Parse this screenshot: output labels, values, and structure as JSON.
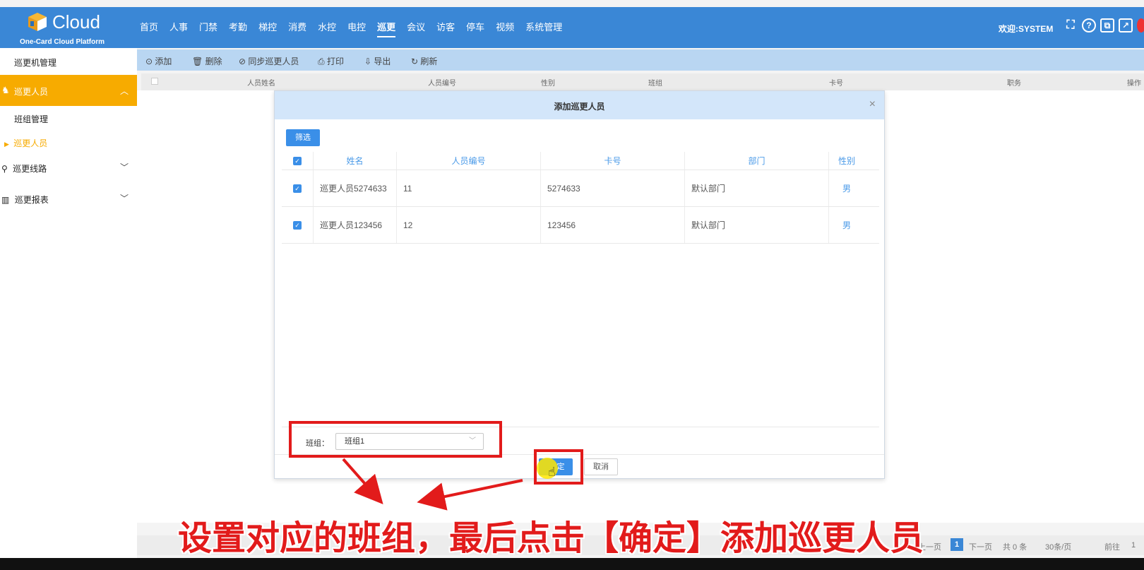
{
  "header": {
    "logo_text": "Cloud",
    "logo_sub": "One-Card Cloud Platform",
    "nav": [
      "首页",
      "人事",
      "门禁",
      "考勤",
      "梯控",
      "消费",
      "水控",
      "电控",
      "巡更",
      "会议",
      "访客",
      "停车",
      "视频",
      "系统管理"
    ],
    "active_nav": "巡更",
    "welcome": "欢迎:SYSTEM"
  },
  "sidebar": {
    "patrol_machine": "巡更机管理",
    "patrol_person": "巡更人员",
    "group_manage": "班组管理",
    "patrol_person_sub": "巡更人员",
    "patrol_route": "巡更线路",
    "patrol_report": "巡更报表"
  },
  "toolbar": {
    "add": "添加",
    "delete": "删除",
    "sync": "同步巡更人员",
    "print": "打印",
    "export": "导出",
    "refresh": "刷新"
  },
  "grid": {
    "columns": [
      "人员姓名",
      "人员编号",
      "性别",
      "班组",
      "卡号",
      "职务",
      "操作"
    ]
  },
  "pager": {
    "prev": "上一页",
    "current": "1",
    "next": "下一页",
    "total": "共 0 条",
    "page_size": "30条/页",
    "goto_label": "前往",
    "goto_value": "1"
  },
  "modal": {
    "title": "添加巡更人员",
    "filter_btn": "筛选",
    "columns": [
      "姓名",
      "人员编号",
      "卡号",
      "部门",
      "性别"
    ],
    "rows": [
      {
        "name": "巡更人员5274633",
        "id": "11",
        "card": "5274633",
        "dept": "默认部门",
        "sex": "男"
      },
      {
        "name": "巡更人员123456",
        "id": "12",
        "card": "123456",
        "dept": "默认部门",
        "sex": "男"
      }
    ],
    "group_label": "班组：",
    "group_value": "班组1",
    "ok_btn": "定",
    "cancel_btn": "取消"
  },
  "caption": "设置对应的班组，最后点击【确定】添加巡更人员",
  "colors": {
    "header_blue": "#3a87d6",
    "sidebar_active": "#f7ab00",
    "annotation_red": "#e21b1b"
  }
}
